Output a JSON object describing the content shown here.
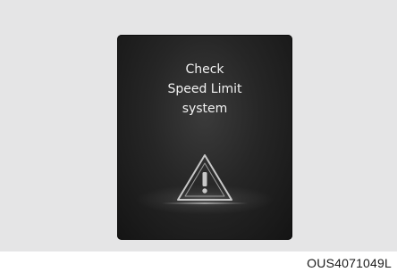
{
  "display": {
    "message_lines": [
      "Check",
      "Speed Limit",
      "system"
    ],
    "icon": "warning-triangle-icon"
  },
  "figure_code": "OUS4071049L",
  "colors": {
    "panel_background": "#e5e5e6",
    "display_background": "#1c1c1c",
    "text": "#f2f2f2"
  }
}
